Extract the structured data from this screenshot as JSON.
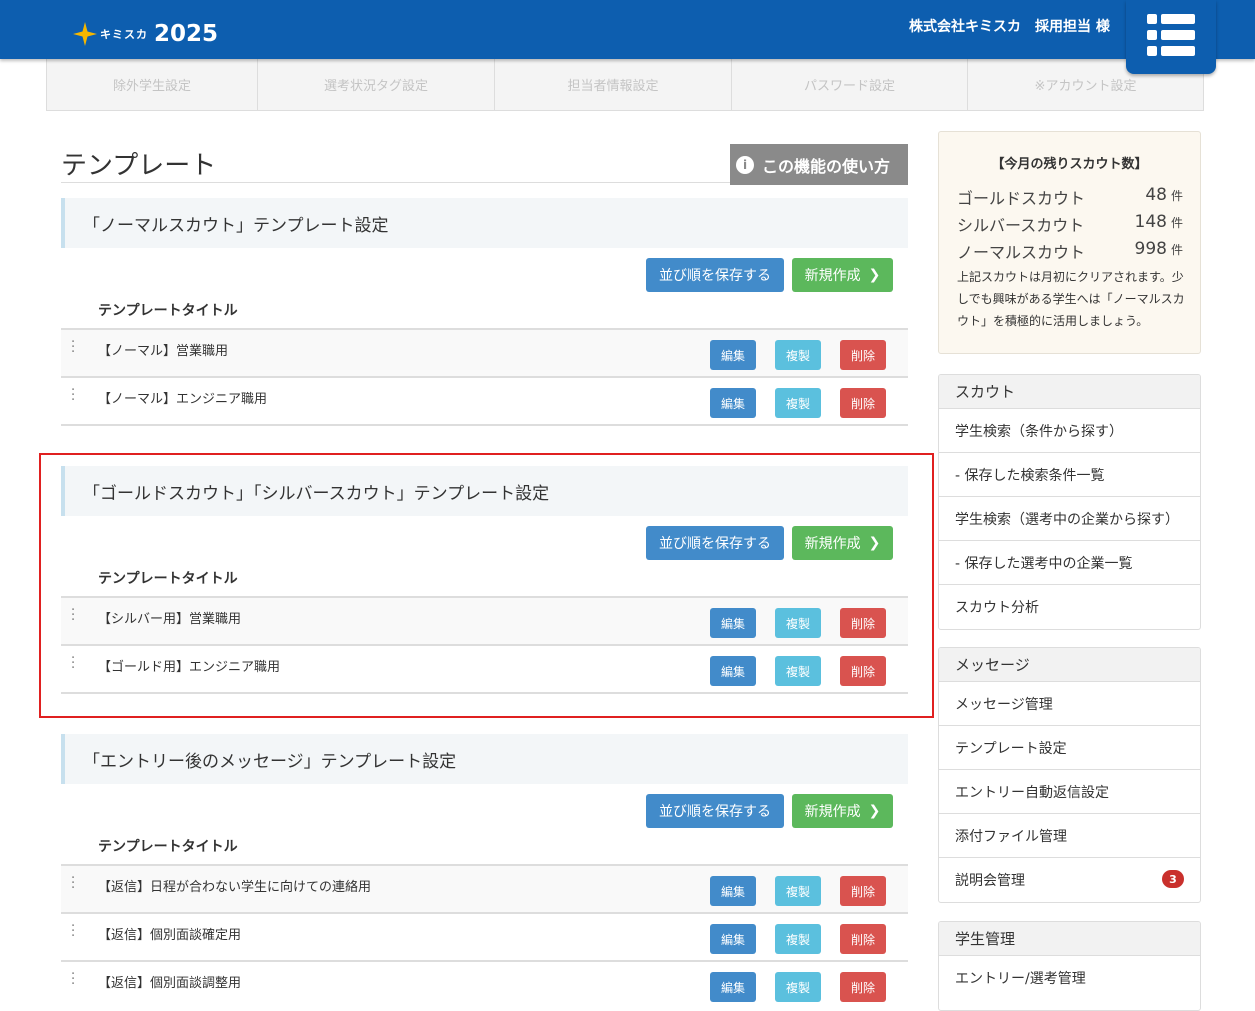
{
  "header": {
    "logo_text": "キミスカ",
    "logo_year": "2025",
    "company": "株式会社キミスカ　採用担当 様",
    "brand_color": "#0d5eaf",
    "menu_icon": "list-menu-icon"
  },
  "tabs": [
    {
      "label": "除外学生設定"
    },
    {
      "label": "選考状況タグ設定"
    },
    {
      "label": "担当者情報設定"
    },
    {
      "label": "パスワード設定"
    },
    {
      "label": "※アカウント設定"
    }
  ],
  "page": {
    "title": "テンプレート",
    "howto": "この機能の使い方",
    "howto_icon": "info-icon"
  },
  "labels": {
    "save_order": "並び順を保存する",
    "new": "新規作成",
    "col_title": "テンプレートタイトル",
    "edit": "編集",
    "copy": "複製",
    "delete": "削除"
  },
  "sections": [
    {
      "heading": "「ノーマルスカウト」テンプレート設定",
      "rows": [
        "【ノーマル】営業職用",
        "【ノーマル】エンジニア職用"
      ]
    },
    {
      "heading": "「ゴールドスカウト」「シルバースカウト」テンプレート設定",
      "rows": [
        "【シルバー用】営業職用",
        "【ゴールド用】エンジニア職用"
      ]
    },
    {
      "heading": "「エントリー後のメッセージ」テンプレート設定",
      "rows": [
        "【返信】日程が合わない学生に向けての連絡用",
        "【返信】個別面談確定用",
        "【返信】個別面談調整用"
      ]
    }
  ],
  "scout_remaining": {
    "heading": "【今月の残りスカウト数】",
    "items": [
      {
        "label": "ゴールドスカウト",
        "count": "48",
        "unit": "件"
      },
      {
        "label": "シルバースカウト",
        "count": "148",
        "unit": "件"
      },
      {
        "label": "ノーマルスカウト",
        "count": "998",
        "unit": "件"
      }
    ],
    "note": "上記スカウトは月初にクリアされます。少しでも興味がある学生へは「ノーマルスカウト」を積極的に活用しましょう。"
  },
  "menus": [
    {
      "heading": "スカウト",
      "items": [
        {
          "label": "学生検索（条件から探す）"
        },
        {
          "label": "- 保存した検索条件一覧"
        },
        {
          "label": "学生検索（選考中の企業から探す）"
        },
        {
          "label": "- 保存した選考中の企業一覧"
        },
        {
          "label": "スカウト分析"
        }
      ]
    },
    {
      "heading": "メッセージ",
      "items": [
        {
          "label": "メッセージ管理"
        },
        {
          "label": "テンプレート設定"
        },
        {
          "label": "エントリー自動返信設定"
        },
        {
          "label": "添付ファイル管理"
        },
        {
          "label": "説明会管理",
          "badge": "3"
        }
      ]
    },
    {
      "heading": "学生管理",
      "items": [
        {
          "label": "エントリー/選考管理"
        }
      ]
    }
  ]
}
